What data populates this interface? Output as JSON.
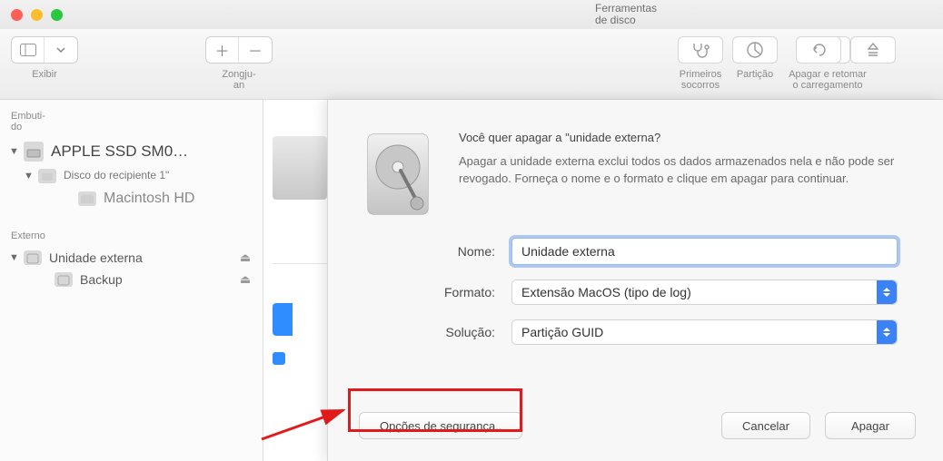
{
  "app_title": "Ferramentas\nde disco",
  "toolbar": {
    "view_label": "Exibir",
    "zoom_user_label": "Zongju-\nan",
    "first_aid": "Primeiros\nsocorros",
    "partition": "Partição",
    "erase_restore": "Apagar e retomar o carregamento"
  },
  "sidebar": {
    "internal_header": "Embuti-\ndo",
    "external_header": "Externo",
    "internal_disk": "APPLE SSD SM0…",
    "container": "Disco do recipiente 1\"",
    "volume1": "Macintosh HD",
    "external_disk": "Unidade externa",
    "external_vol": "Backup"
  },
  "dialog": {
    "question": "Você quer apagar a \"unidade externa?",
    "description": "Apagar a unidade externa exclui todos os dados armazenados nela e não pode ser revogado. Forneça o nome e o formato e clique em apagar para continuar.",
    "name_label": "Nome:",
    "name_value": "Unidade externa",
    "format_label": "Formato:",
    "format_value": "Extensão MacOS (tipo de log)",
    "scheme_label": "Solução:",
    "scheme_value": "Partição GUID",
    "security_btn": "Opções de segurança..",
    "cancel_btn": "Cancelar",
    "erase_btn": "Apagar"
  }
}
